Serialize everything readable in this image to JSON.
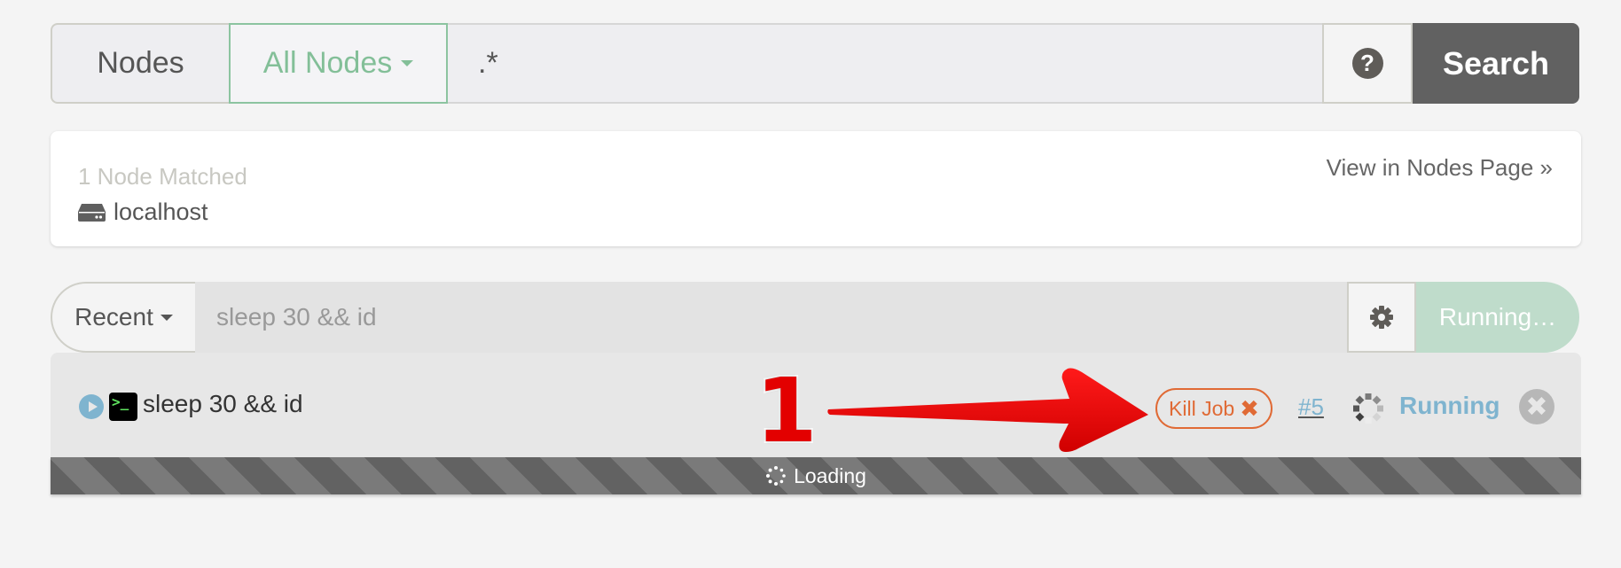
{
  "search": {
    "scope_label": "Nodes",
    "filter_dropdown": "All Nodes",
    "filter_value": ".*",
    "help_icon": "question-circle-icon",
    "search_button": "Search"
  },
  "matched": {
    "count_text": "1 Node Matched",
    "nodes": [
      {
        "icon": "hdd-icon",
        "name": "localhost"
      }
    ],
    "view_link": "View in Nodes Page »"
  },
  "command": {
    "recent_label": "Recent",
    "input_value": "sleep 30 && id",
    "settings_icon": "gear-icon",
    "run_button": "Running…"
  },
  "job": {
    "command_text": "sleep 30 && id",
    "terminal_glyph": ">_",
    "kill_button": "Kill Job",
    "kill_icon": "✖",
    "job_number": "#5",
    "status": "Running",
    "close_icon": "✖",
    "loading_text": "Loading"
  },
  "annotation": {
    "step_number": "1",
    "color": "#e30000"
  },
  "colors": {
    "accent_green": "#83bf98",
    "status_blue": "#7fb4cf",
    "kill_orange": "#e06a35",
    "search_btn": "#616161"
  }
}
